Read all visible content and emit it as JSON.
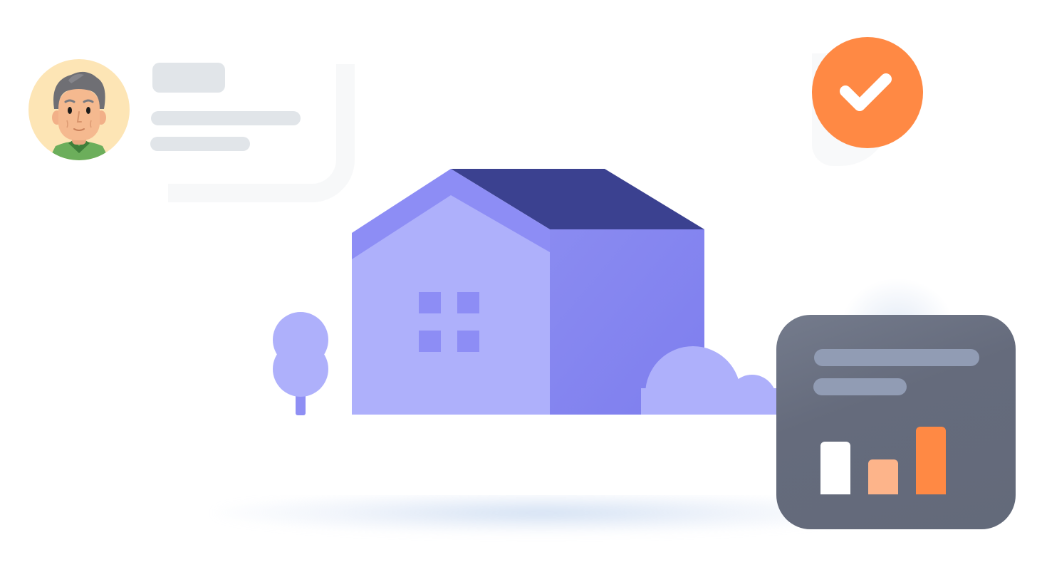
{
  "colors": {
    "background": "#ffffff",
    "card": "#ffffff",
    "placeholder_gray": "#e1e5e9",
    "accent_orange": "#ff8944",
    "light_orange": "#fdb48a",
    "house_light": "#aeb0fb",
    "house_mid": "#8d8df5",
    "house_dark": "#3b4190",
    "house_side": "#8383ee",
    "stats_card": "#656b7c",
    "stats_line": "#919cb4"
  },
  "icons": {
    "avatar": "elderly-man-avatar-icon",
    "check": "check-icon",
    "house": "house-icon",
    "tree": "tree-icon",
    "bush": "bush-icon"
  },
  "stats_card": {
    "bars": [
      {
        "value": 0.78,
        "color": "#ffffff"
      },
      {
        "value": 0.52,
        "color": "#fdb48a"
      },
      {
        "value": 1.0,
        "color": "#ff8944"
      }
    ]
  }
}
